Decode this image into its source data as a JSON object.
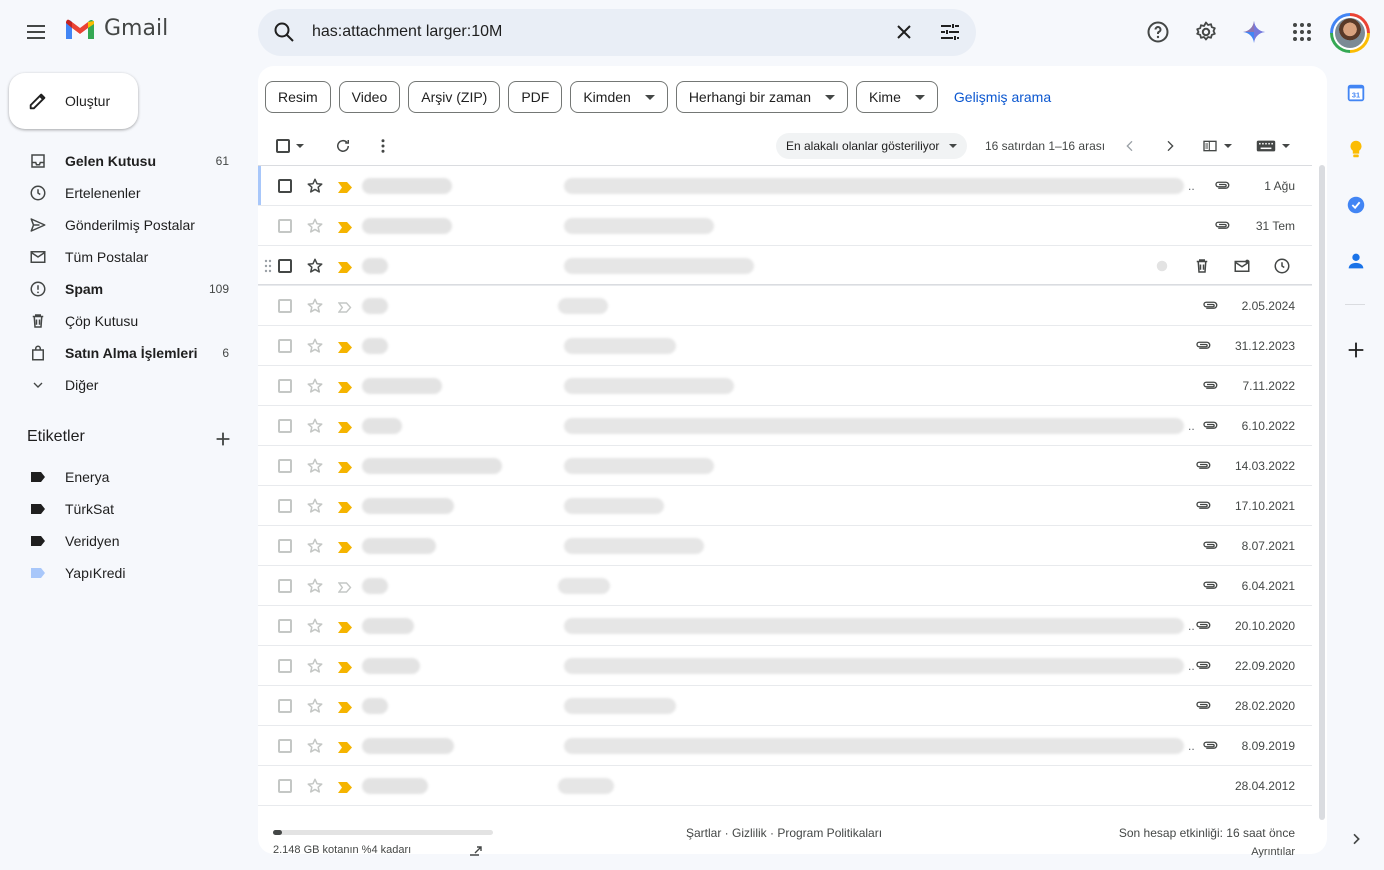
{
  "app": {
    "name": "Gmail"
  },
  "search": {
    "query": "has:attachment larger:10M"
  },
  "compose": {
    "label": "Oluştur"
  },
  "nav": [
    {
      "label": "Gelen Kutusu",
      "count": "61",
      "bold": true,
      "icon": "inbox-icon"
    },
    {
      "label": "Ertelenenler",
      "count": "",
      "bold": false,
      "icon": "snooze-icon"
    },
    {
      "label": "Gönderilmiş Postalar",
      "count": "",
      "bold": false,
      "icon": "send-icon"
    },
    {
      "label": "Tüm Postalar",
      "count": "",
      "bold": false,
      "icon": "all-mail-icon"
    },
    {
      "label": "Spam",
      "count": "109",
      "bold": true,
      "icon": "spam-icon"
    },
    {
      "label": "Çöp Kutusu",
      "count": "",
      "bold": false,
      "icon": "trash-icon"
    },
    {
      "label": "Satın Alma İşlemleri",
      "count": "6",
      "bold": true,
      "icon": "shopping-bag-icon"
    },
    {
      "label": "Diğer",
      "count": "",
      "bold": false,
      "icon": "chevron-down-icon"
    }
  ],
  "labels_section": {
    "title": "Etiketler"
  },
  "labels": [
    {
      "name": "Enerya",
      "color": "#1f1f1f"
    },
    {
      "name": "TürkSat",
      "color": "#1f1f1f"
    },
    {
      "name": "Veridyen",
      "color": "#1f1f1f"
    },
    {
      "name": "YapıKredi",
      "color": "#a8c7fa"
    }
  ],
  "filter_chips": [
    {
      "label": "Resim",
      "dropdown": false
    },
    {
      "label": "Video",
      "dropdown": false
    },
    {
      "label": "Arşiv (ZIP)",
      "dropdown": false
    },
    {
      "label": "PDF",
      "dropdown": false
    },
    {
      "label": "Kimden",
      "dropdown": true
    },
    {
      "label": "Herhangi bir zaman",
      "dropdown": true
    },
    {
      "label": "Kime",
      "dropdown": true
    }
  ],
  "advanced_search": "Gelişmiş arama",
  "toolbar": {
    "sort_label": "En alakalı olanlar gösteriliyor",
    "page_count": "16 satırdan 1–16 arası"
  },
  "emails": [
    {
      "date": "1 Ağu",
      "important": true,
      "attachment": true,
      "truncated": true
    },
    {
      "date": "31 Tem",
      "important": true,
      "attachment": true,
      "truncated": false
    },
    {
      "date": "",
      "important": true,
      "attachment": false,
      "truncated": false,
      "hovered": true
    },
    {
      "date": "2.05.2024",
      "important": false,
      "attachment": true,
      "truncated": false
    },
    {
      "date": "31.12.2023",
      "important": true,
      "attachment": true,
      "truncated": false
    },
    {
      "date": "7.11.2022",
      "important": true,
      "attachment": true,
      "truncated": false
    },
    {
      "date": "6.10.2022",
      "important": true,
      "attachment": true,
      "truncated": true
    },
    {
      "date": "14.03.2022",
      "important": true,
      "attachment": true,
      "truncated": false
    },
    {
      "date": "17.10.2021",
      "important": true,
      "attachment": true,
      "truncated": false
    },
    {
      "date": "8.07.2021",
      "important": true,
      "attachment": true,
      "truncated": false
    },
    {
      "date": "6.04.2021",
      "important": false,
      "attachment": true,
      "truncated": false
    },
    {
      "date": "20.10.2020",
      "important": true,
      "attachment": true,
      "truncated": true
    },
    {
      "date": "22.09.2020",
      "important": true,
      "attachment": true,
      "truncated": true
    },
    {
      "date": "28.02.2020",
      "important": true,
      "attachment": true,
      "truncated": false
    },
    {
      "date": "8.09.2019",
      "important": true,
      "attachment": true,
      "truncated": true
    },
    {
      "date": "28.04.2012",
      "important": true,
      "attachment": false,
      "truncated": false
    }
  ],
  "footer": {
    "storage_text": "2.148 GB kotanın %4 kadarı",
    "storage_used": 0.04,
    "links": "Şartlar · Gizlilik · Program Politikaları",
    "last_activity": "Son hesap etkinliği: 16 saat önce",
    "details": "Ayrıntılar"
  },
  "colors": {
    "accent": "#0b57d0",
    "important": "#f5b400",
    "background": "#f6f8fc"
  }
}
